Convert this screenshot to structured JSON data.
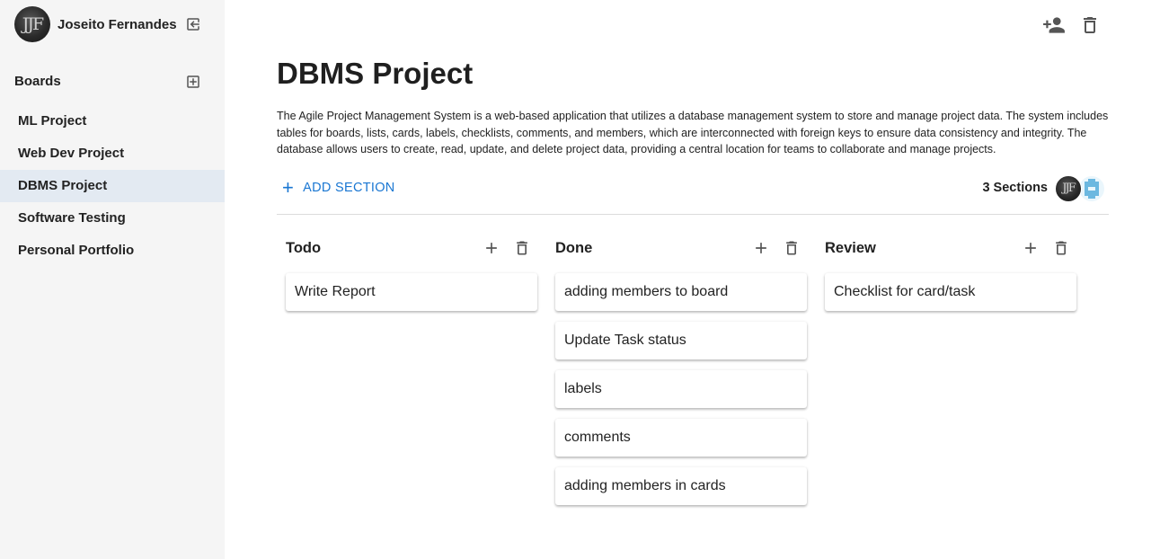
{
  "sidebar": {
    "user_name": "Joseito Fernandes",
    "boards_title": "Boards",
    "boards": [
      {
        "label": "ML Project"
      },
      {
        "label": "Web Dev Project"
      },
      {
        "label": "DBMS Project",
        "active": true
      },
      {
        "label": "Software Testing"
      },
      {
        "label": "Personal Portfolio"
      }
    ],
    "icons": {
      "logout": "logout-icon",
      "add_board": "add-box-icon"
    }
  },
  "topbar": {
    "icons": [
      "person-add-icon",
      "delete-icon"
    ]
  },
  "board": {
    "title": "DBMS Project",
    "description": "The Agile Project Management System is a web-based application that utilizes a database management system to store and manage project data. The system includes tables for boards, lists, cards, labels, checklists, comments, and members, which are interconnected with foreign keys to ensure data consistency and integrity. The database allows users to create, read, update, and delete project data, providing a central location for teams to collaborate and manage projects.",
    "add_section_label": "ADD SECTION",
    "sections_count_label": "3 Sections",
    "member_count": 2
  },
  "sections": [
    {
      "title": "Todo",
      "cards": [
        "Write Report"
      ]
    },
    {
      "title": "Done",
      "cards": [
        "adding members to board",
        "Update Task status",
        "labels",
        "comments",
        "adding members in cards"
      ]
    },
    {
      "title": "Review",
      "cards": [
        "Checklist for card/task"
      ]
    }
  ],
  "colors": {
    "accent": "#1976d2",
    "sidebar_bg": "#f5f5f5",
    "active_item_bg": "#e3eaf2"
  }
}
